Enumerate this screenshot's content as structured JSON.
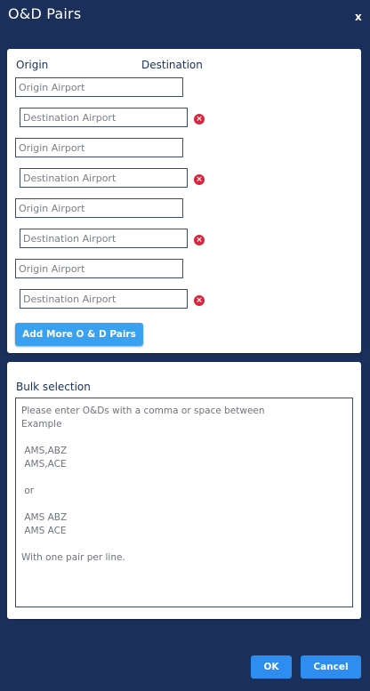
{
  "dialog": {
    "title": "O&D Pairs",
    "close_label": "x"
  },
  "pairs_section": {
    "origin_label": "Origin",
    "destination_label": "Destination",
    "origin_placeholder": "Origin Airport",
    "destination_placeholder": "Destination Airport",
    "remove_icon": "remove-circle-icon",
    "pairs": [
      {
        "origin": "",
        "destination": ""
      },
      {
        "origin": "",
        "destination": ""
      },
      {
        "origin": "",
        "destination": ""
      },
      {
        "origin": "",
        "destination": ""
      }
    ],
    "add_button_label": "Add More O & D Pairs"
  },
  "bulk_section": {
    "label": "Bulk selection",
    "value": "",
    "placeholder": "Please enter O&Ds with a comma or space between\nExample\n\n AMS,ABZ\n AMS,ACE\n\n or\n\n AMS ABZ\n AMS ACE\n\nWith one pair per line."
  },
  "footer": {
    "ok_label": "OK",
    "cancel_label": "Cancel"
  },
  "colors": {
    "background": "#1b2f5b",
    "accent": "#2e8ef0",
    "remove": "#d7263d"
  }
}
